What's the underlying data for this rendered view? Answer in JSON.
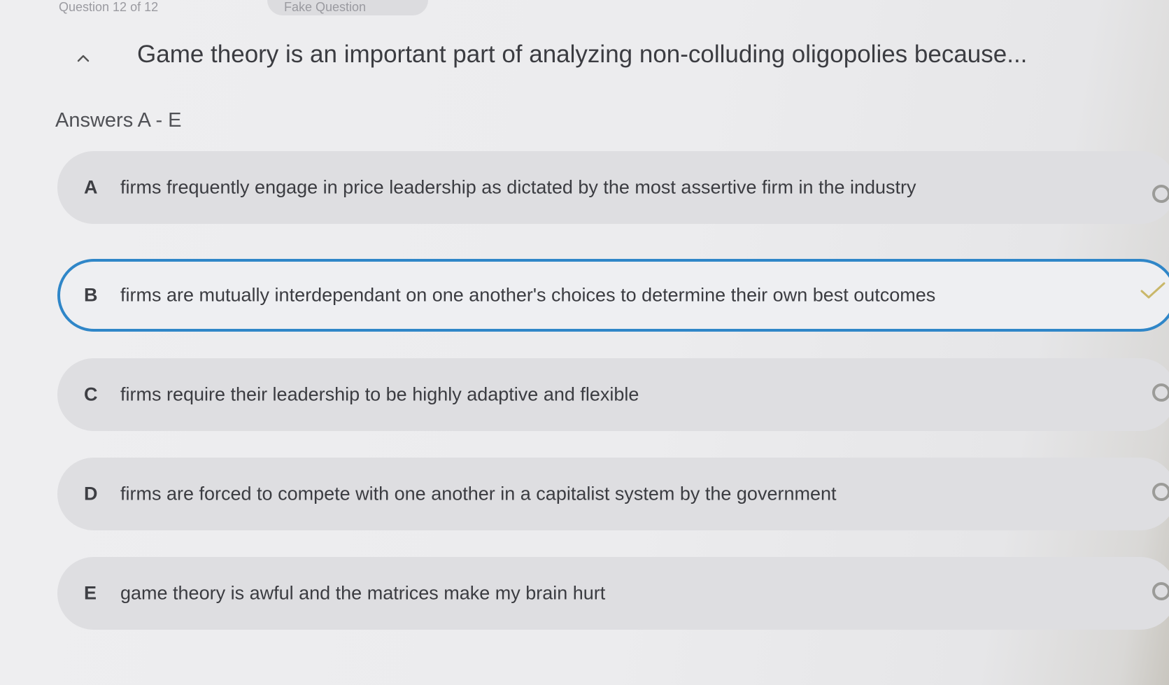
{
  "header": {
    "question_counter": "Question 12 of 12",
    "tab_label": "Fake Question"
  },
  "question": {
    "text": "Game theory is an important part of analyzing non-colluding oligopolies because...",
    "answers_label": "Answers A - E"
  },
  "options": [
    {
      "letter": "A",
      "text": "firms frequently engage in price leadership as dictated by the most assertive firm in the industry",
      "selected": false
    },
    {
      "letter": "B",
      "text": "firms are mutually interdependant on one another's choices to determine their own best outcomes",
      "selected": true
    },
    {
      "letter": "C",
      "text": "firms require their leadership to be highly adaptive and flexible",
      "selected": false
    },
    {
      "letter": "D",
      "text": "firms are forced to compete with one another in a capitalist system by the government",
      "selected": false
    },
    {
      "letter": "E",
      "text": "game theory is awful and the matrices make my brain hurt",
      "selected": false
    }
  ],
  "icons": {
    "collapse": "chevron-up-icon",
    "selected_indicator": "check-icon",
    "unselected_indicator": "radio-ring-icon"
  },
  "colors": {
    "selected_border": "#2f86c8",
    "check": "#c9b76a",
    "option_bg": "#dedee1"
  }
}
